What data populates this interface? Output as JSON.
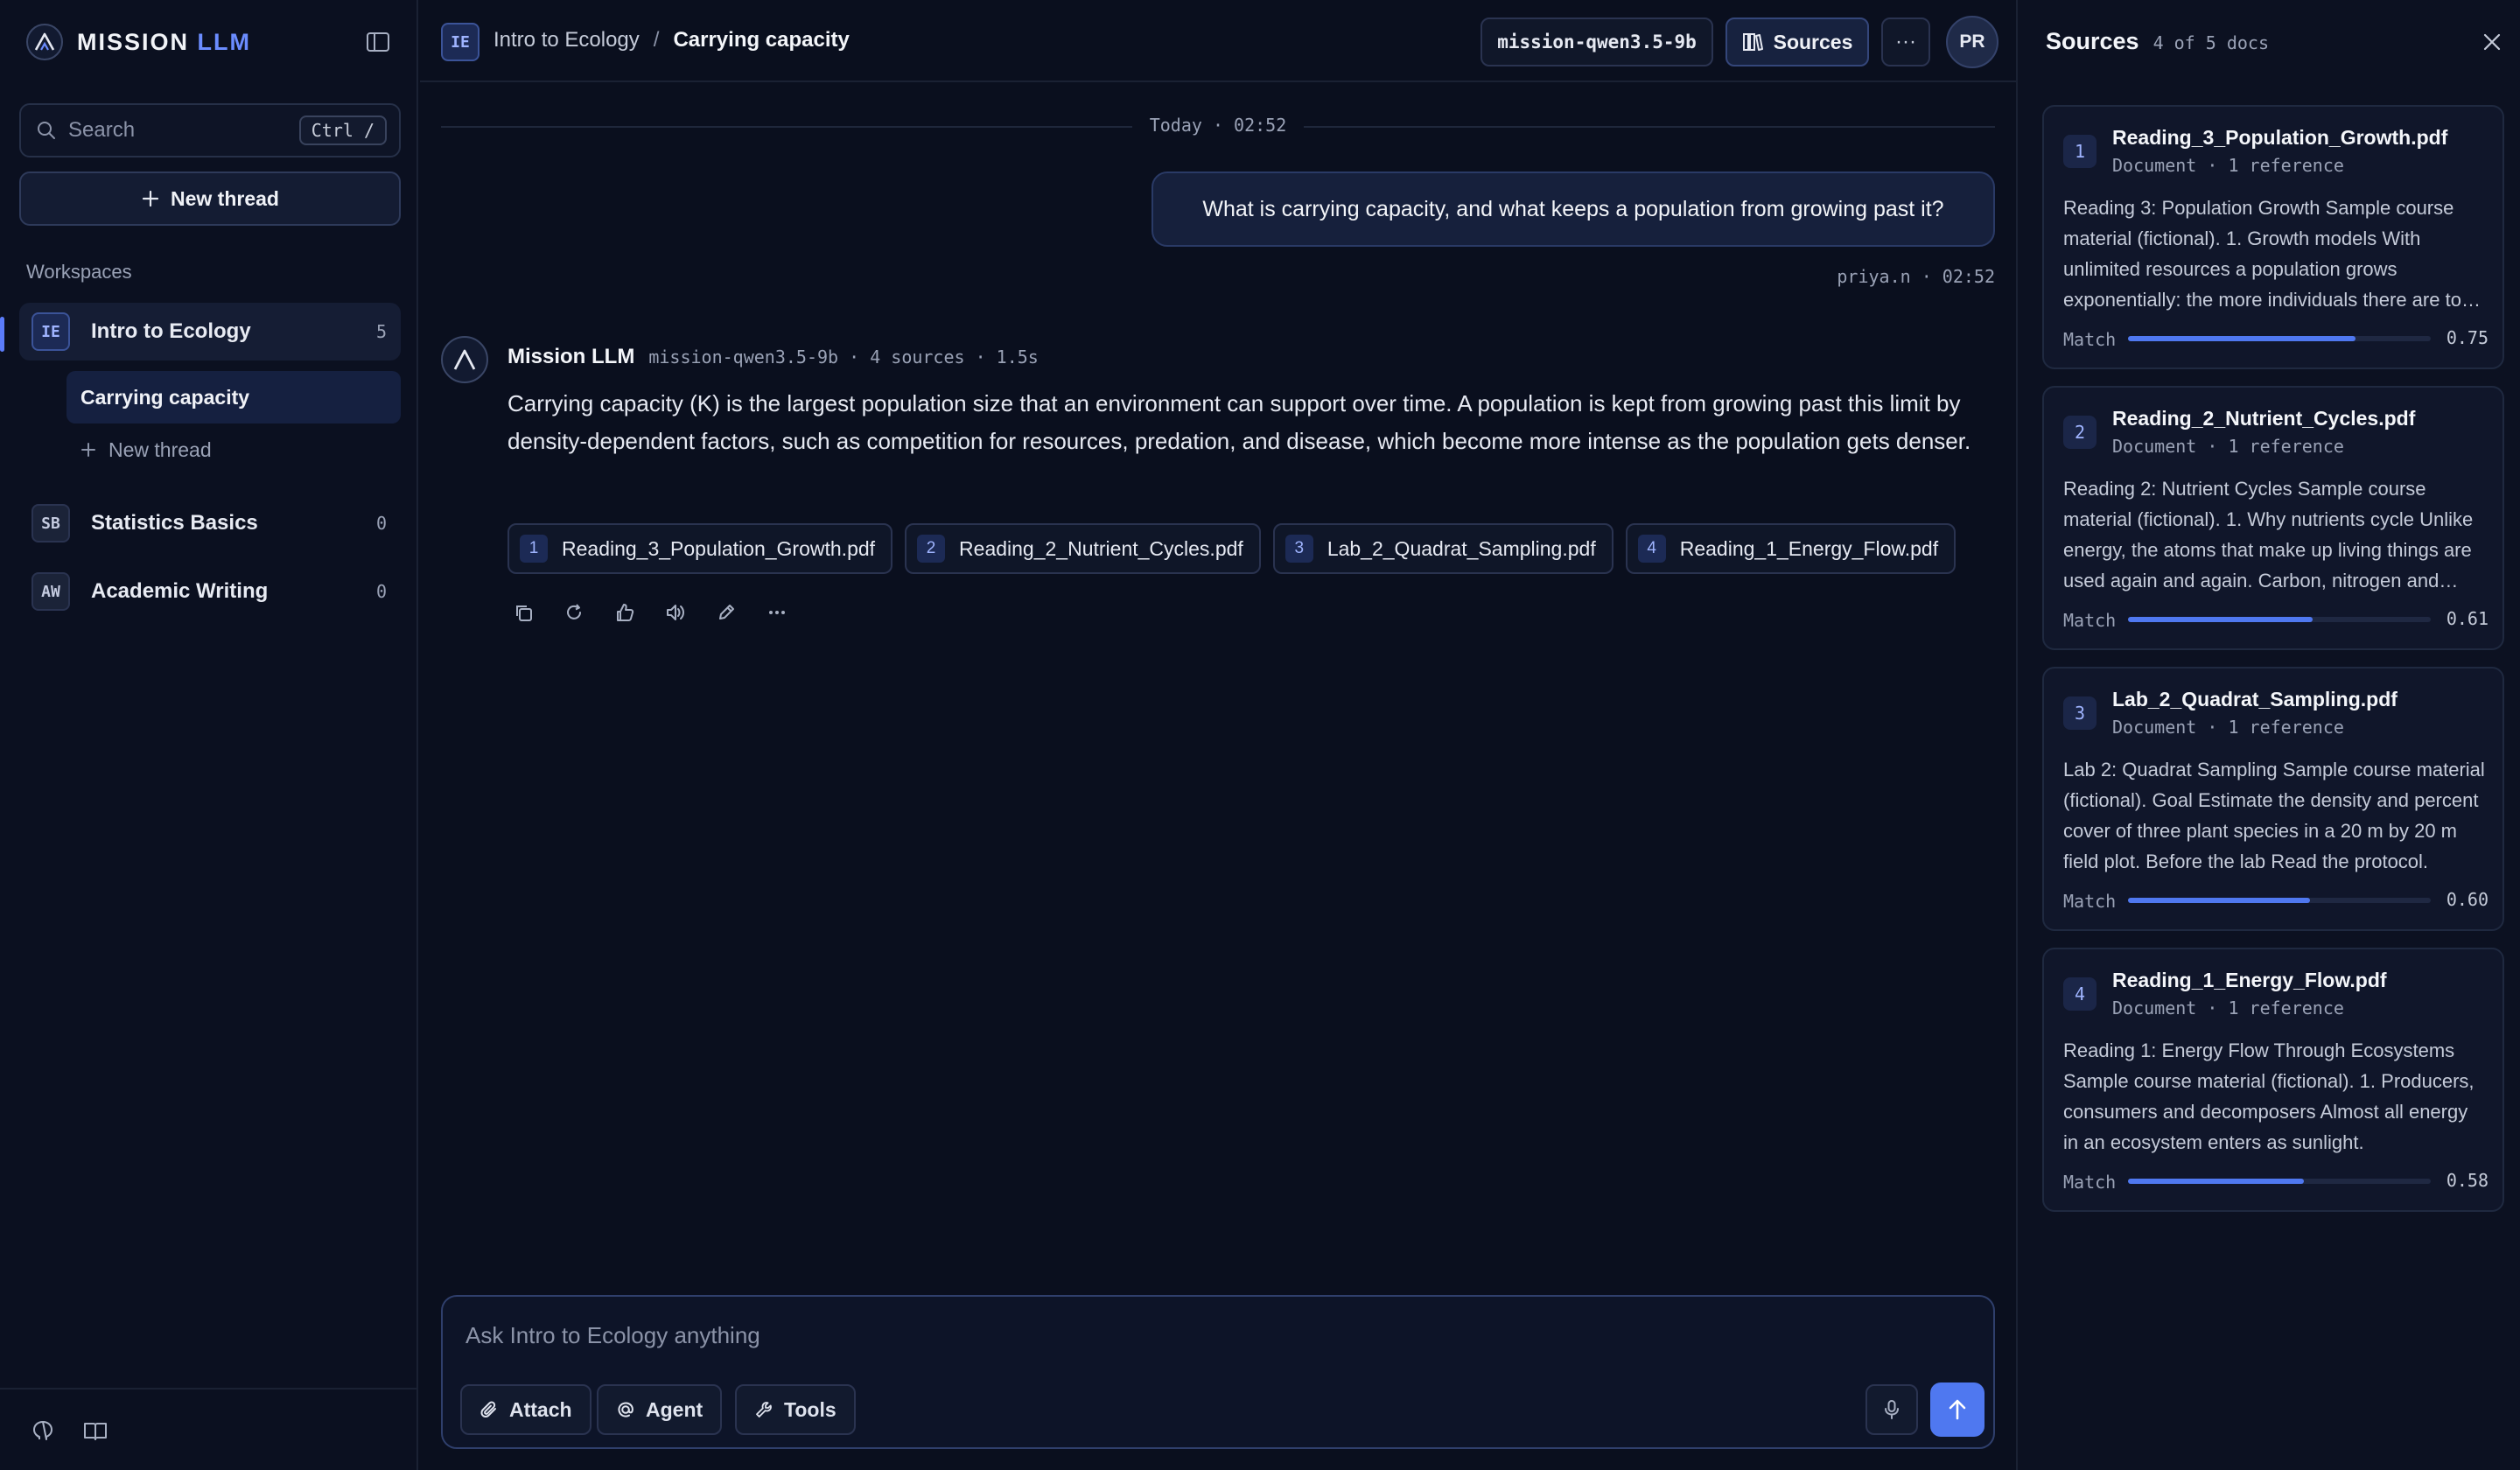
{
  "brand": {
    "name_part1": "MISSION",
    "name_part2": "LLM"
  },
  "sidebar": {
    "search_placeholder": "Search",
    "search_shortcut": "Ctrl /",
    "new_thread_label": "New thread",
    "workspaces_heading": "Workspaces",
    "workspaces": [
      {
        "badge": "IE",
        "label": "Intro to Ecology",
        "count": "5",
        "active": true
      },
      {
        "badge": "SB",
        "label": "Statistics Basics",
        "count": "0",
        "active": false
      },
      {
        "badge": "AW",
        "label": "Academic Writing",
        "count": "0",
        "active": false
      }
    ],
    "threads": [
      {
        "label": "Carrying capacity",
        "active": true
      }
    ],
    "sub_new_thread_label": "New thread",
    "footer_icons": [
      "github-icon",
      "book-icon"
    ]
  },
  "header": {
    "workspace_badge": "IE",
    "workspace_name": "Intro to Ecology",
    "separator": "/",
    "thread_title": "Carrying capacity",
    "model": "mission-qwen3.5-9b",
    "sources_label": "Sources",
    "more_label": "···",
    "avatar_initials": "PR"
  },
  "chat": {
    "day_divider": "Today · 02:52",
    "user_message": {
      "text": "What is carrying capacity, and what keeps a population from growing past it?",
      "meta": "priya.n · 02:52"
    },
    "assistant_message": {
      "name": "Mission LLM",
      "meta": "mission-qwen3.5-9b · 4 sources · 1.5s",
      "text": "Carrying capacity (K) is the largest population size that an environment can support over time. A population is kept from growing past this limit by density-dependent factors, such as competition for resources, predation, and disease, which become more intense as the population gets denser.",
      "citations": [
        {
          "num": "1",
          "label": "Reading_3_Population_Growth.pdf"
        },
        {
          "num": "2",
          "label": "Reading_2_Nutrient_Cycles.pdf"
        },
        {
          "num": "3",
          "label": "Lab_2_Quadrat_Sampling.pdf"
        },
        {
          "num": "4",
          "label": "Reading_1_Energy_Flow.pdf"
        }
      ],
      "actions": [
        "copy-icon",
        "regenerate-icon",
        "thumbs-up-icon",
        "speaker-icon",
        "edit-icon",
        "more-icon"
      ]
    }
  },
  "composer": {
    "placeholder": "Ask Intro to Ecology anything",
    "attach_label": "Attach",
    "agent_label": "Agent",
    "tools_label": "Tools"
  },
  "sources_panel": {
    "title": "Sources",
    "subtitle": "4 of 5 docs",
    "match_label": "Match",
    "sources": [
      {
        "num": "1",
        "name": "Reading_3_Population_Growth.pdf",
        "meta": "Document · 1 reference",
        "excerpt": "Reading 3: Population Growth Sample course material (fictional). 1. Growth models With unlimited resources a population grows exponentially: the more individuals there are to reproduce, the faster it grows.",
        "score": "0.75"
      },
      {
        "num": "2",
        "name": "Reading_2_Nutrient_Cycles.pdf",
        "meta": "Document · 1 reference",
        "excerpt": "Reading 2: Nutrient Cycles Sample course material (fictional). 1. Why nutrients cycle Unlike energy, the atoms that make up living things are used again and again. Carbon, nitrogen and phosphorus cycle.",
        "score": "0.61"
      },
      {
        "num": "3",
        "name": "Lab_2_Quadrat_Sampling.pdf",
        "meta": "Document · 1 reference",
        "excerpt": "Lab 2: Quadrat Sampling Sample course material (fictional). Goal Estimate the density and percent cover of three plant species in a 20 m by 20 m field plot. Before the lab Read the protocol.",
        "score": "0.60"
      },
      {
        "num": "4",
        "name": "Reading_1_Energy_Flow.pdf",
        "meta": "Document · 1 reference",
        "excerpt": "Reading 1: Energy Flow Through Ecosystems Sample course material (fictional). 1. Producers, consumers and decomposers Almost all energy in an ecosystem enters as sunlight.",
        "score": "0.58"
      }
    ]
  },
  "colors": {
    "accent": "#4f78f0",
    "background": "#0a0f1e",
    "panel": "#0c1121"
  }
}
